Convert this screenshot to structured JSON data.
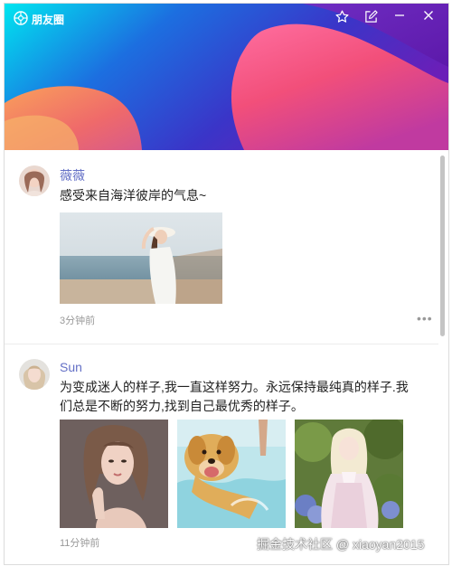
{
  "window": {
    "title": "朋友圈"
  },
  "titlebar": {
    "icons": [
      "star-icon",
      "edit-icon",
      "minimize-icon",
      "close-icon"
    ]
  },
  "posts": [
    {
      "user": "薇薇",
      "text": "感受来自海洋彼岸的气息~",
      "time": "3分钟前",
      "more": "•••",
      "photos": [
        "beach-girl-photo"
      ]
    },
    {
      "user": "Sun",
      "text_line1": "为变成迷人的样子,我一直这样努力。永远保持最纯真的样子.我",
      "text_line2": "们总是不断的努力,找到自己最优秀的样子。",
      "time": "11分钟前",
      "photos": [
        "portrait-girl-photo",
        "golden-retriever-photo",
        "cosplay-girl-photo"
      ]
    }
  ],
  "watermark": "掘金技术社区 @ xiaoyan2015",
  "colors": {
    "username": "#6470c6",
    "header_start": "#00e0ee",
    "header_end": "#6a1fb8"
  }
}
